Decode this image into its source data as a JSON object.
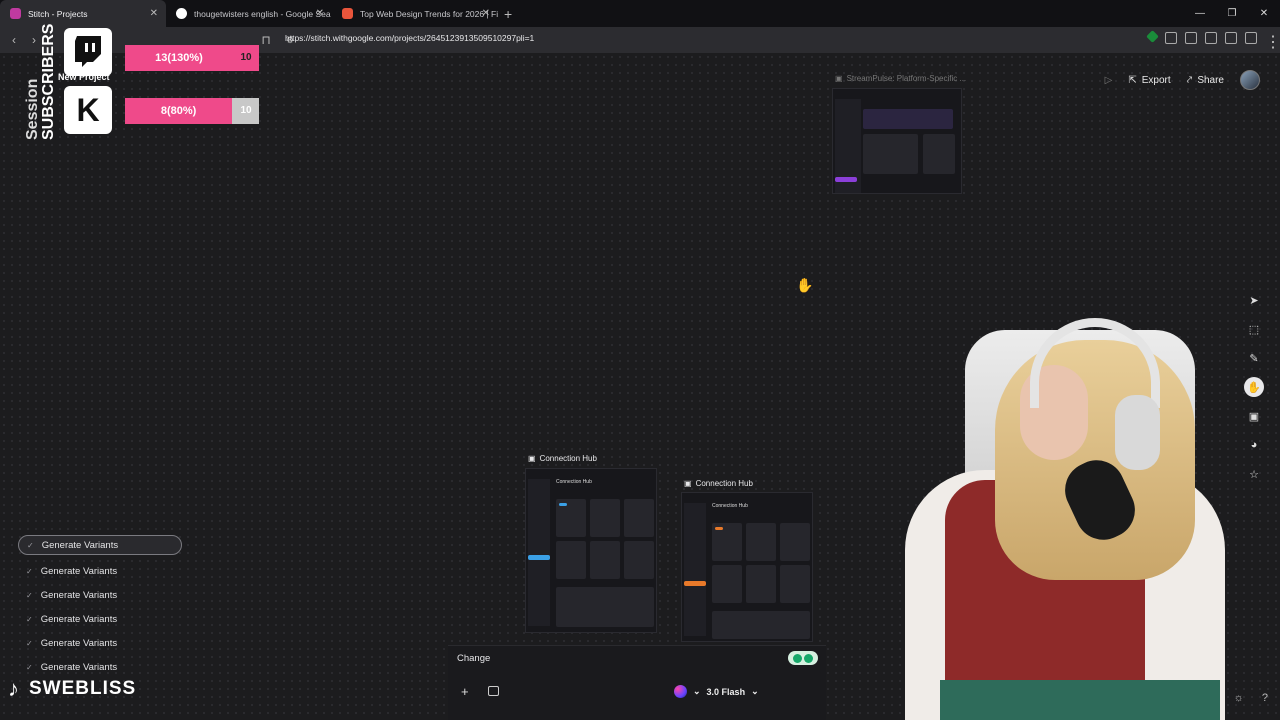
{
  "browser": {
    "tabs": [
      {
        "label": "Stitch - Projects",
        "active": true
      },
      {
        "label": "thougetwisters english - Google Sea"
      },
      {
        "label": "Top Web Design Trends for 2026 | Fig"
      }
    ],
    "url": "https://stitch.withgoogle.com/projects/2645123913509510297pli=1"
  },
  "header": {
    "export_label": "Export",
    "share_label": "Share"
  },
  "overlay": {
    "session_label": "Session",
    "subscribers_label": "SUBSCRIBERS",
    "new_project_label": "New Project",
    "twitch": {
      "progress": "13(130%)",
      "goal": "10"
    },
    "kick": {
      "progress": "8(80%)",
      "goal": "10"
    },
    "kick_letter": "K",
    "tiktok_name": "SWEBLISS"
  },
  "frames": [
    {
      "title": "StreamPulse: Platform-Specific ..."
    },
    {
      "title": "Connection Hub"
    },
    {
      "title": "Connection Hub"
    }
  ],
  "thumb_text": {
    "hdr": "Connection Hub"
  },
  "variants": [
    {
      "label": "Generate Variants",
      "selected": true
    },
    {
      "label": "Generate Variants"
    },
    {
      "label": "Generate Variants"
    },
    {
      "label": "Generate Variants"
    },
    {
      "label": "Generate Variants"
    },
    {
      "label": "Generate Variants"
    }
  ],
  "prompt": {
    "text": "Change",
    "model_label": "3.0 Flash"
  },
  "colors": {
    "accent_pink": "#ef4a8a",
    "canvas_bg": "#1c1c1e"
  }
}
